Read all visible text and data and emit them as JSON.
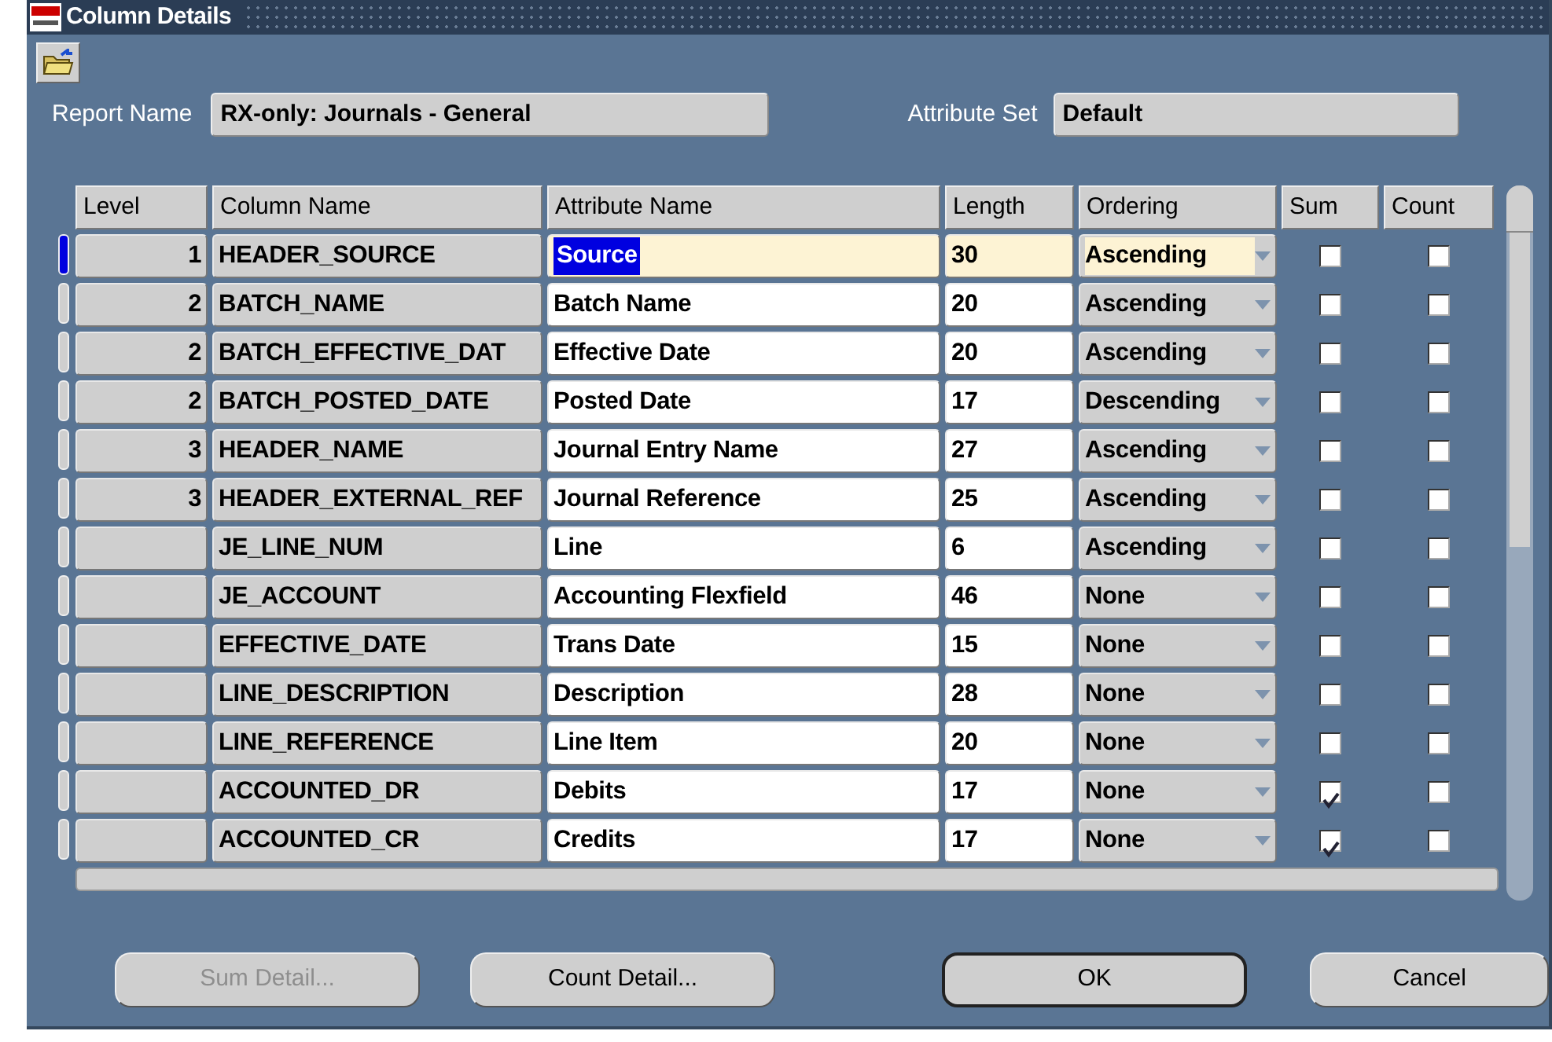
{
  "window": {
    "title": "Column Details"
  },
  "form": {
    "report_name_label": "Report Name",
    "report_name": "RX-only: Journals - General",
    "attribute_set_label": "Attribute Set",
    "attribute_set": "Default"
  },
  "table": {
    "columns": [
      "Level",
      "Column Name",
      "Attribute Name",
      "Length",
      "Ordering",
      "Sum",
      "Count"
    ],
    "rows": [
      {
        "selected": true,
        "level": "1",
        "column_name": "HEADER_SOURCE",
        "attribute_name": "Source",
        "length": "30",
        "ordering": "Ascending",
        "sum": false,
        "count": false
      },
      {
        "selected": false,
        "level": "2",
        "column_name": "BATCH_NAME",
        "attribute_name": "Batch Name",
        "length": "20",
        "ordering": "Ascending",
        "sum": false,
        "count": false
      },
      {
        "selected": false,
        "level": "2",
        "column_name": "BATCH_EFFECTIVE_DAT",
        "attribute_name": "Effective Date",
        "length": "20",
        "ordering": "Ascending",
        "sum": false,
        "count": false
      },
      {
        "selected": false,
        "level": "2",
        "column_name": "BATCH_POSTED_DATE",
        "attribute_name": "Posted Date",
        "length": "17",
        "ordering": "Descending",
        "sum": false,
        "count": false
      },
      {
        "selected": false,
        "level": "3",
        "column_name": "HEADER_NAME",
        "attribute_name": "Journal Entry Name",
        "length": "27",
        "ordering": "Ascending",
        "sum": false,
        "count": false
      },
      {
        "selected": false,
        "level": "3",
        "column_name": "HEADER_EXTERNAL_REF",
        "attribute_name": "Journal Reference",
        "length": "25",
        "ordering": "Ascending",
        "sum": false,
        "count": false
      },
      {
        "selected": false,
        "column_name": "JE_LINE_NUM",
        "attribute_name": "Line",
        "length": "6",
        "ordering": "Ascending",
        "sum": false,
        "count": false
      },
      {
        "selected": false,
        "column_name": "JE_ACCOUNT",
        "attribute_name": "Accounting Flexfield",
        "length": "46",
        "ordering": "None",
        "sum": false,
        "count": false
      },
      {
        "selected": false,
        "column_name": "EFFECTIVE_DATE",
        "attribute_name": "Trans Date",
        "length": "15",
        "ordering": "None",
        "sum": false,
        "count": false
      },
      {
        "selected": false,
        "column_name": "LINE_DESCRIPTION",
        "attribute_name": "Description",
        "length": "28",
        "ordering": "None",
        "sum": false,
        "count": false
      },
      {
        "selected": false,
        "column_name": "LINE_REFERENCE",
        "attribute_name": "Line Item",
        "length": "20",
        "ordering": "None",
        "sum": false,
        "count": false
      },
      {
        "selected": false,
        "column_name": "ACCOUNTED_DR",
        "attribute_name": "Debits",
        "length": "17",
        "ordering": "None",
        "sum": true,
        "count": false
      },
      {
        "selected": false,
        "column_name": "ACCOUNTED_CR",
        "attribute_name": "Credits",
        "length": "17",
        "ordering": "None",
        "sum": true,
        "count": false
      }
    ]
  },
  "buttons": [
    {
      "label": "Sum Detail...",
      "disabled": true,
      "kind": "normal"
    },
    {
      "label": "Count Detail...",
      "disabled": false,
      "kind": "normal"
    },
    {
      "label": "OK",
      "disabled": false,
      "kind": "default"
    },
    {
      "label": "Cancel",
      "disabled": false,
      "kind": "normal"
    }
  ]
}
